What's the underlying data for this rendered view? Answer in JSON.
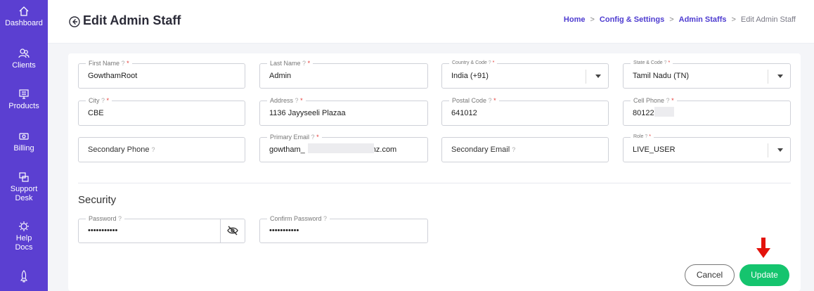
{
  "sidebar": {
    "items": [
      {
        "label": "Dashboard",
        "icon": "home-icon"
      },
      {
        "label": "Clients",
        "icon": "users-icon"
      },
      {
        "label": "Products",
        "icon": "products-icon"
      },
      {
        "label": "Billing",
        "icon": "billing-icon"
      },
      {
        "label": "Support Desk",
        "icon": "support-icon"
      },
      {
        "label": "Help Docs",
        "icon": "help-docs-icon"
      },
      {
        "label": "",
        "icon": "rocket-icon"
      }
    ],
    "color": "#5b3fd1"
  },
  "header": {
    "title": "Edit Admin Staff",
    "breadcrumb": {
      "home": "Home",
      "config": "Config & Settings",
      "admin_staffs": "Admin Staffs",
      "current": "Edit Admin Staff",
      "separator": ">"
    }
  },
  "form": {
    "first_name": {
      "label": "First Name",
      "value": "GowthamRoot"
    },
    "last_name": {
      "label": "Last Name",
      "value": "Admin"
    },
    "country_code": {
      "label": "Country & Code",
      "value": "India (+91)"
    },
    "state_code": {
      "label": "State & Code",
      "value": "Tamil Nadu (TN)"
    },
    "city": {
      "label": "City",
      "value": "CBE"
    },
    "address": {
      "label": "Address",
      "value": "1136 Jayyseeli Plazaa"
    },
    "postal_code": {
      "label": "Postal Code",
      "value": "641012"
    },
    "cell_phone": {
      "label": "Cell Phone",
      "value": "80122"
    },
    "secondary_phone": {
      "placeholder": "Secondary Phone"
    },
    "primary_email": {
      "label": "Primary Email",
      "value_prefix": "gowtham_",
      "value_suffix": "nz.com"
    },
    "secondary_email": {
      "placeholder": "Secondary Email"
    },
    "role": {
      "label": "Role",
      "value": "LIVE_USER"
    },
    "required_mark": "*",
    "help_mark": "?"
  },
  "security": {
    "title": "Security",
    "password": {
      "label": "Password",
      "value": "•••••••••••"
    },
    "confirm_password": {
      "label": "Confirm Password",
      "value": "•••••••••••"
    }
  },
  "actions": {
    "cancel": "Cancel",
    "update": "Update",
    "update_color": "#15c46e",
    "arrow_color": "#e3120b"
  }
}
